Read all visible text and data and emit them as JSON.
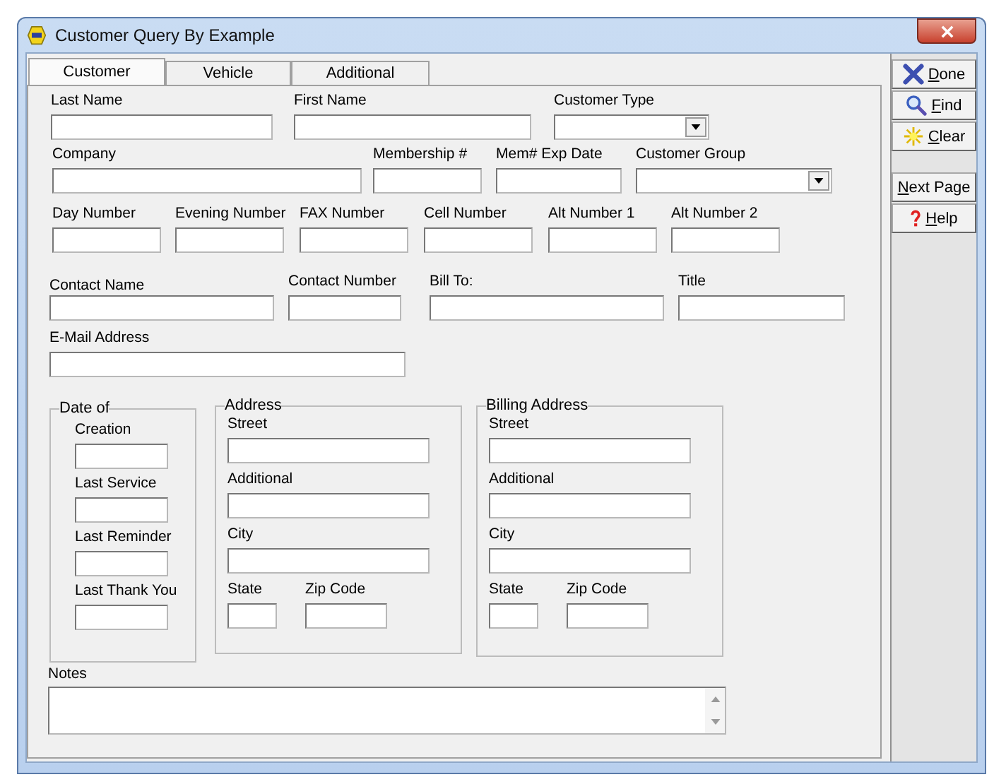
{
  "window": {
    "title": "Customer Query By Example"
  },
  "tabs": [
    {
      "label": "Customer",
      "selected": true
    },
    {
      "label": "Vehicle",
      "selected": false
    },
    {
      "label": "Additional",
      "selected": false
    }
  ],
  "rows": [
    {
      "fields": [
        {
          "label": "Last Name",
          "kind": "text"
        },
        {
          "label": "First Name",
          "kind": "text"
        },
        {
          "label": "Customer Type",
          "kind": "dropdown"
        }
      ]
    },
    {
      "fields": [
        {
          "label": "Company",
          "kind": "text"
        },
        {
          "label": "Membership #",
          "kind": "text"
        },
        {
          "label": "Mem# Exp Date",
          "kind": "text"
        },
        {
          "label": "Customer Group",
          "kind": "dropdown"
        }
      ]
    },
    {
      "fields": [
        {
          "label": "Day Number",
          "kind": "text"
        },
        {
          "label": "Evening Number",
          "kind": "text"
        },
        {
          "label": "FAX Number",
          "kind": "text"
        },
        {
          "label": "Cell Number",
          "kind": "text"
        },
        {
          "label": "Alt Number 1",
          "kind": "text"
        },
        {
          "label": "Alt Number 2",
          "kind": "text"
        }
      ]
    },
    {
      "fields": [
        {
          "label": "Contact Name",
          "kind": "text"
        },
        {
          "label": "Contact Number",
          "kind": "text"
        },
        {
          "label": "Bill To:",
          "kind": "text"
        },
        {
          "label": "Title",
          "kind": "text"
        }
      ]
    },
    {
      "fields": [
        {
          "label": "E-Mail Address",
          "kind": "text"
        }
      ]
    }
  ],
  "groups": [
    {
      "title": "Date of",
      "rows": [
        {
          "fields": [
            {
              "label": "Creation"
            }
          ]
        },
        {
          "fields": [
            {
              "label": "Last Service"
            }
          ]
        },
        {
          "fields": [
            {
              "label": "Last Reminder"
            }
          ]
        },
        {
          "fields": [
            {
              "label": "Last Thank You"
            }
          ]
        }
      ]
    },
    {
      "title": "Address",
      "rows": [
        {
          "fields": [
            {
              "label": "Street"
            }
          ]
        },
        {
          "fields": [
            {
              "label": "Additional"
            }
          ]
        },
        {
          "fields": [
            {
              "label": "City"
            }
          ]
        },
        {
          "fields": [
            {
              "label": "State"
            },
            {
              "label": "Zip Code"
            }
          ]
        }
      ]
    },
    {
      "title": "Billing Address",
      "rows": [
        {
          "fields": [
            {
              "label": "Street"
            }
          ]
        },
        {
          "fields": [
            {
              "label": "Additional"
            }
          ]
        },
        {
          "fields": [
            {
              "label": "City"
            }
          ]
        },
        {
          "fields": [
            {
              "label": "State"
            },
            {
              "label": "Zip Code"
            }
          ]
        }
      ]
    }
  ],
  "notes": {
    "label": "Notes"
  },
  "buttons": [
    {
      "key": "D",
      "rest": "one",
      "kind": "cross"
    },
    {
      "key": "F",
      "rest": "ind",
      "kind": "search"
    },
    {
      "key": "C",
      "rest": "lear",
      "kind": "sparkle"
    },
    {
      "key": "N",
      "rest": "ext Page",
      "kind": "plain"
    },
    {
      "key": "H",
      "rest": "elp",
      "kind": "help"
    }
  ]
}
